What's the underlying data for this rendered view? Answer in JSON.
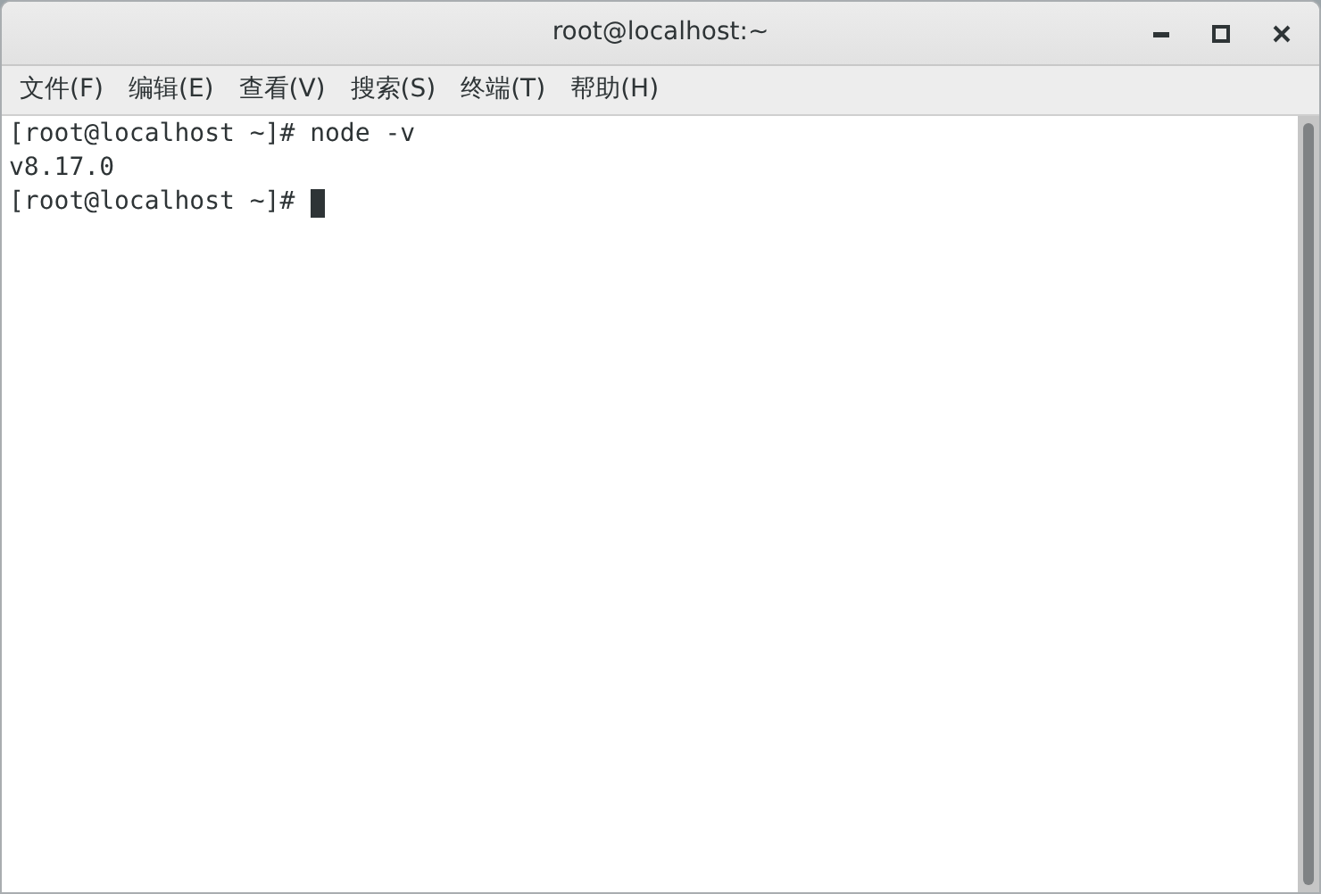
{
  "window": {
    "title": "root@localhost:~"
  },
  "menu": [
    "文件(F)",
    "编辑(E)",
    "查看(V)",
    "搜索(S)",
    "终端(T)",
    "帮助(H)"
  ],
  "terminal": {
    "lines": [
      "[root@localhost ~]# node -v",
      "v8.17.0",
      "[root@localhost ~]# "
    ]
  }
}
